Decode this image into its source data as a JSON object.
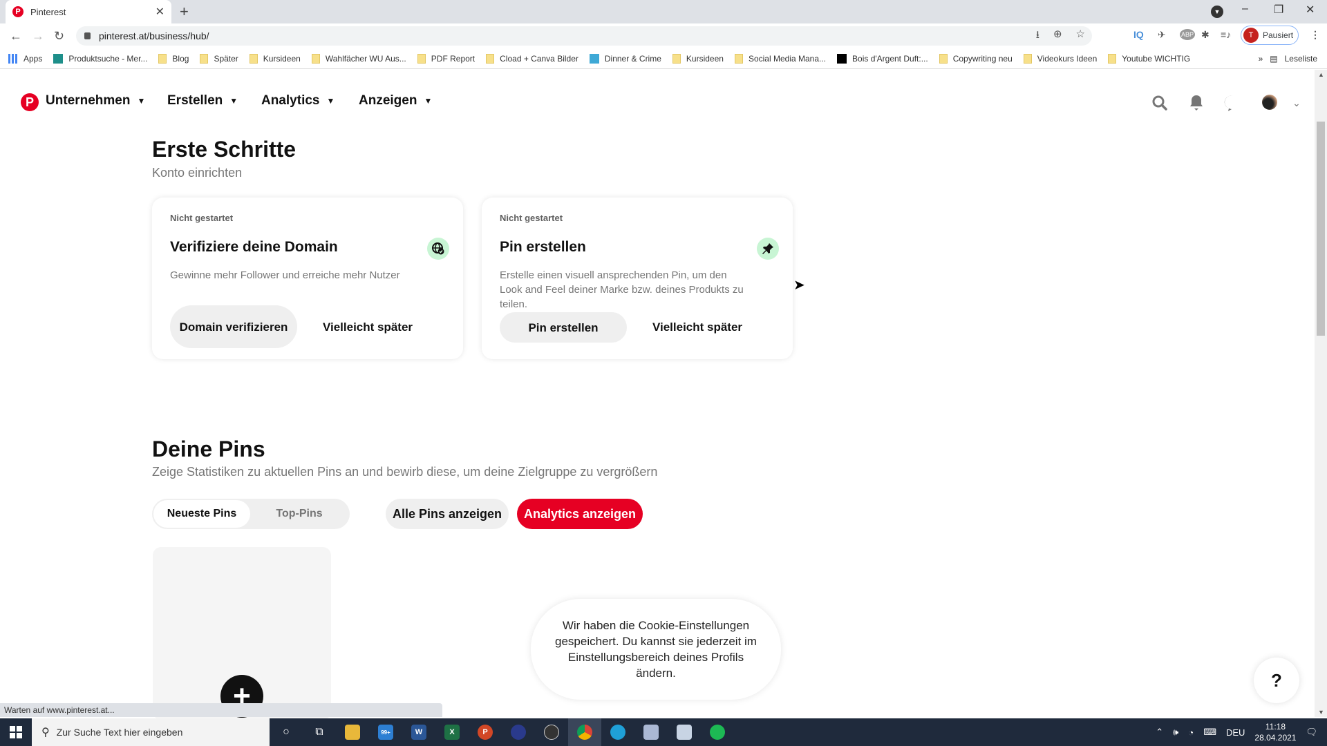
{
  "browser": {
    "tab_title": "Pinterest",
    "tab_close": "✕",
    "new_tab": "+",
    "url": "pinterest.at/business/hub/",
    "profile_status": "Pausiert",
    "profile_initial": "T",
    "window_controls": {
      "minimize": "–",
      "restore": "❐",
      "close": "✕"
    },
    "toolbar_right_icons": [
      "⭳",
      "⊕",
      "☆"
    ],
    "extensions": [
      "IQ",
      "✈",
      "ABP",
      "✱",
      "≡♪"
    ],
    "extension_badge": "0",
    "bookmarks": [
      {
        "label": "Apps",
        "icon": "apps-grid-icon"
      },
      {
        "label": "Produktsuche - Mer...",
        "icon": "shirt-icon"
      },
      {
        "label": "Blog",
        "icon": "folder-icon"
      },
      {
        "label": "Später",
        "icon": "folder-icon"
      },
      {
        "label": "Kursideen",
        "icon": "folder-icon"
      },
      {
        "label": "Wahlfächer WU Aus...",
        "icon": "folder-icon"
      },
      {
        "label": "PDF Report",
        "icon": "folder-icon"
      },
      {
        "label": "Cload + Canva Bilder",
        "icon": "folder-icon"
      },
      {
        "label": "Dinner & Crime",
        "icon": "jd-icon"
      },
      {
        "label": "Kursideen",
        "icon": "folder-icon"
      },
      {
        "label": "Social Media Mana...",
        "icon": "folder-icon"
      },
      {
        "label": "Bois d'Argent Duft:...",
        "icon": "dior-icon"
      },
      {
        "label": "Copywriting neu",
        "icon": "folder-icon"
      },
      {
        "label": "Videokurs Ideen",
        "icon": "folder-icon"
      },
      {
        "label": "Youtube WICHTIG",
        "icon": "folder-icon"
      }
    ],
    "bookmarks_more": "»",
    "reading_list": "Leseliste",
    "status_text": "Warten auf www.pinterest.at..."
  },
  "header": {
    "logo": "P",
    "nav": [
      {
        "label": "Unternehmen"
      },
      {
        "label": "Erstellen"
      },
      {
        "label": "Analytics"
      },
      {
        "label": "Anzeigen"
      }
    ],
    "chevron": "⌄"
  },
  "getting_started": {
    "title": "Erste Schritte",
    "subtitle": "Konto einrichten",
    "cards": [
      {
        "status": "Nicht gestartet",
        "title": "Verifiziere deine Domain",
        "description": "Gewinne mehr Follower und erreiche mehr Nutzer",
        "primary": "Domain verifizieren",
        "secondary": "Vielleicht später",
        "icon": "🌐"
      },
      {
        "status": "Nicht gestartet",
        "title": "Pin erstellen",
        "description": "Erstelle einen visuell ansprechenden Pin, um den Look and Feel deiner Marke bzw. deines Produkts zu teilen.",
        "primary": "Pin erstellen",
        "secondary": "Vielleicht später",
        "icon": "📌"
      }
    ]
  },
  "pins": {
    "title": "Deine Pins",
    "subtitle": "Zeige Statistiken zu aktuellen Pins an und bewirb diese, um deine Zielgruppe zu vergrößern",
    "tabs": [
      {
        "label": "Neueste Pins",
        "active": true
      },
      {
        "label": "Top-Pins",
        "active": false
      }
    ],
    "all_pins": "Alle Pins anzeigen",
    "analytics": "Analytics anzeigen",
    "add": "+"
  },
  "toast": "Wir haben die Cookie-Einstellungen gespeichert. Du kannst sie jederzeit im Einstellungsbereich deines Profils ändern.",
  "help": "?",
  "colors": {
    "brand": "#e60023",
    "success_bg": "#c8f5d4"
  },
  "taskbar": {
    "search_placeholder": "Zur Suche Text hier eingeben",
    "mail_badge": "99+",
    "language": "DEU",
    "time": "11:18",
    "date": "28.04.2021"
  }
}
